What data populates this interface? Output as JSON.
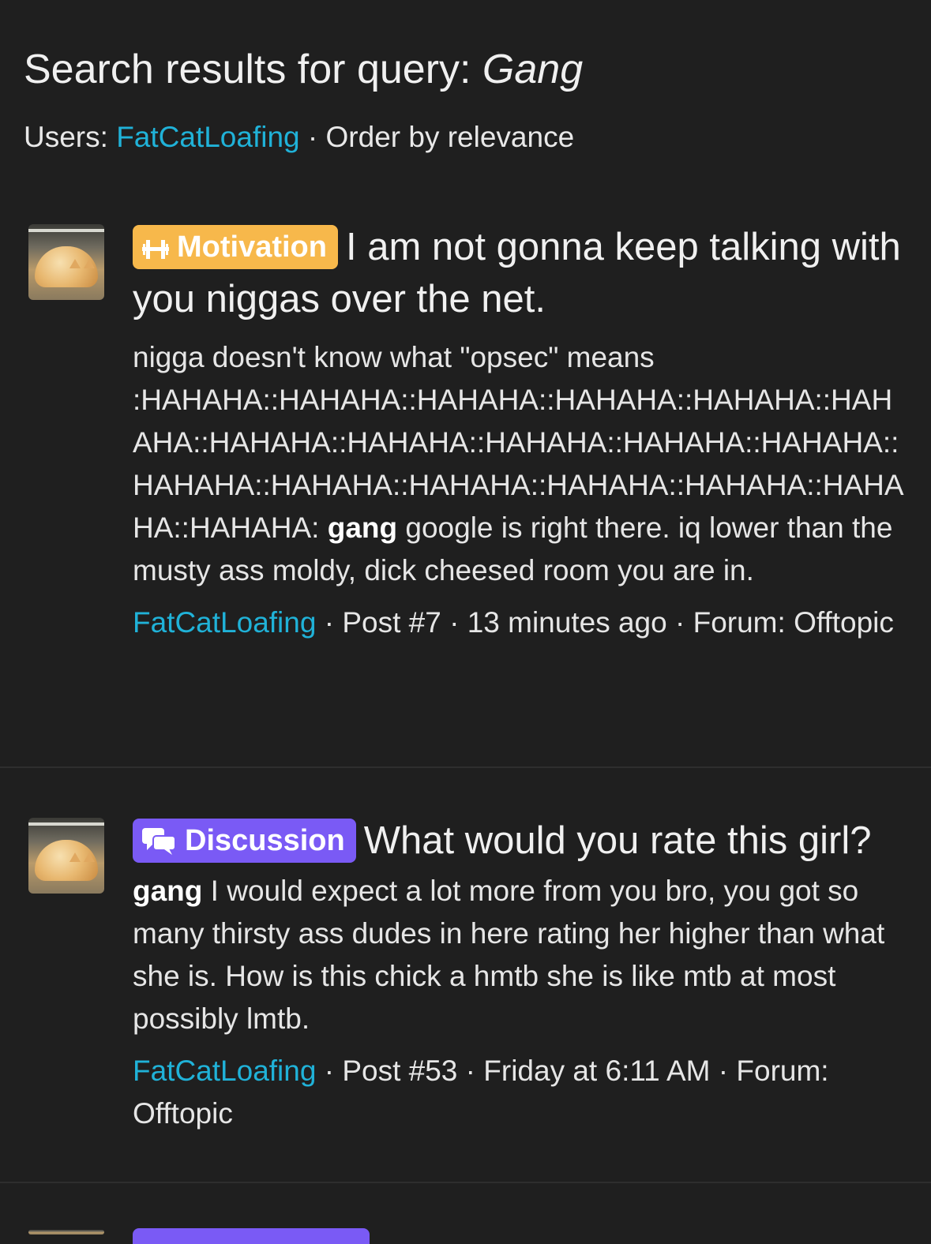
{
  "search": {
    "title_prefix": "Search results for query:",
    "query": "Gang",
    "users_label": "Users:",
    "user": "FatCatLoafing",
    "sep": " · ",
    "order": "Order by relevance"
  },
  "results": [
    {
      "label": "Motivation",
      "label_color": "#f7b84b",
      "label_icon": "dumbbell-icon",
      "title": "I am not gonna keep talking with you niggas over the net.",
      "snippet_before": "nigga doesn't know what \"opsec\" means :HAHAHA::HAHAHA::HAHAHA::HAHAHA::HAHAHA::HAHAHA::HAHAHA::HAHAHA::HAHAHA::HAHAHA::HAHAHA::HAHAHA::HAHAHA::HAHAHA::HAHAHA::HAHAHA::HAHAHA::HAHAHA: ",
      "snippet_bold": "gang",
      "snippet_after": " google is right there. iq lower than the musty ass moldy, dick cheesed room you are in.",
      "author": "FatCatLoafing",
      "post": "Post #7",
      "time": "13 minutes ago",
      "forum_label": "Forum:",
      "forum": "Offtopic"
    },
    {
      "label": "Discussion",
      "label_color": "#7a5af5",
      "label_icon": "chat-bubbles-icon",
      "title": "What would you rate this girl?",
      "snippet_before": "",
      "snippet_bold": "gang",
      "snippet_after": " I would expect a lot more from you bro, you got so many thirsty ass dudes in here rating her higher than what she is. How is this chick a hmtb she is like mtb at most possibly lmtb.",
      "author": "FatCatLoafing",
      "post": "Post #53",
      "time": "Friday at 6:11 AM",
      "forum_label": "Forum:",
      "forum": "Offtopic"
    }
  ]
}
